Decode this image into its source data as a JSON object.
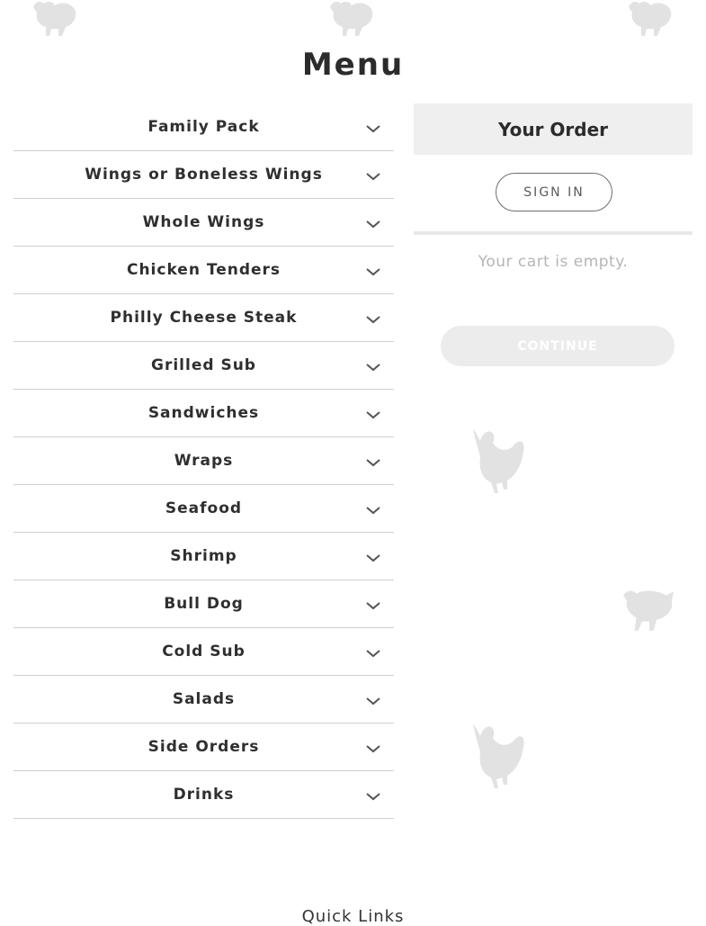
{
  "page": {
    "title": "Menu"
  },
  "menu": {
    "categories": [
      {
        "label": "Family Pack"
      },
      {
        "label": "Wings or Boneless Wings"
      },
      {
        "label": "Whole Wings"
      },
      {
        "label": "Chicken Tenders"
      },
      {
        "label": "Philly Cheese Steak"
      },
      {
        "label": "Grilled Sub"
      },
      {
        "label": "Sandwiches"
      },
      {
        "label": "Wraps"
      },
      {
        "label": "Seafood"
      },
      {
        "label": "Shrimp"
      },
      {
        "label": "Bull Dog"
      },
      {
        "label": "Cold Sub"
      },
      {
        "label": "Salads"
      },
      {
        "label": "Side Orders"
      },
      {
        "label": "Drinks"
      }
    ],
    "expand_icon": "chevron-down-icon"
  },
  "order": {
    "title": "Your Order",
    "sign_in_label": "SIGN IN",
    "empty_message": "Your cart is empty.",
    "continue_label": "CONTINUE"
  },
  "footer": {
    "quick_links_label": "Quick Links"
  },
  "colors": {
    "text": "#2d2d2d",
    "panel_header_bg": "#efefef",
    "muted_text": "#b5b5b5",
    "disabled_button_bg": "#ececec",
    "decoration": "#d9d9d9"
  }
}
